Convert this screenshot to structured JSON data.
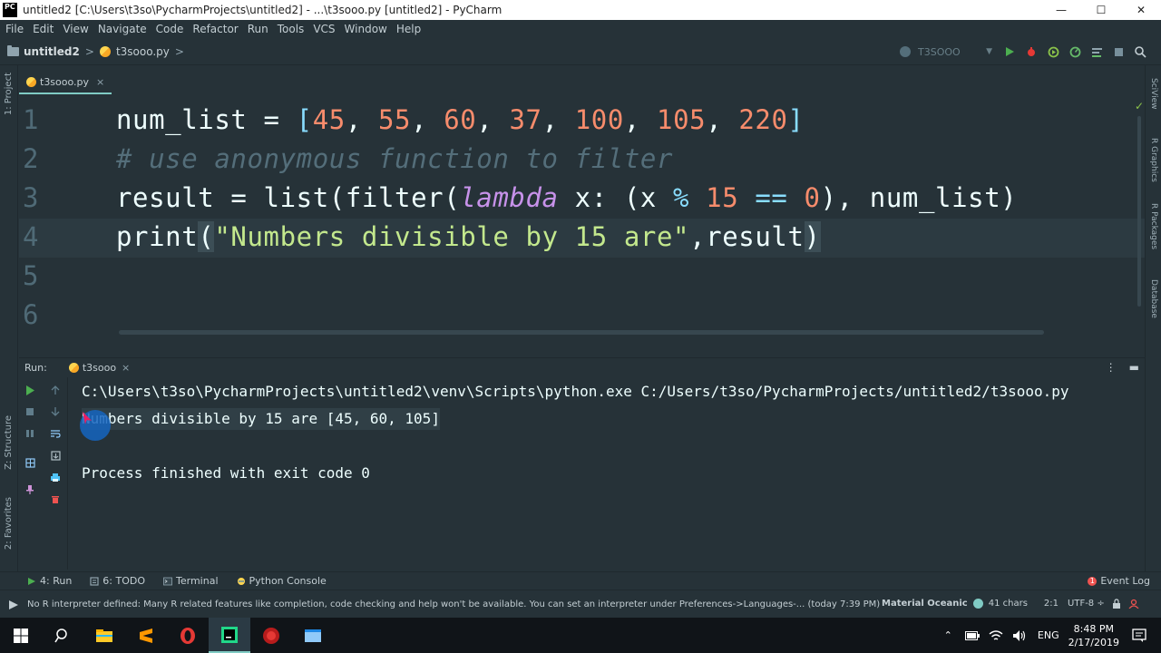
{
  "window": {
    "title": "untitled2 [C:\\Users\\t3so\\PycharmProjects\\untitled2] - ...\\t3sooo.py [untitled2] - PyCharm",
    "app_icon_text": "PC",
    "minimize": "—",
    "maximize": "☐",
    "close": "✕"
  },
  "menu": [
    "File",
    "Edit",
    "View",
    "Navigate",
    "Code",
    "Refactor",
    "Run",
    "Tools",
    "VCS",
    "Window",
    "Help"
  ],
  "nav": {
    "project": "untitled2",
    "sep": ">",
    "file": "t3sooo.py",
    "run_config": "T3SOOO"
  },
  "left_strip": {
    "project_label": "1: Project",
    "structure_label": "Z: Structure",
    "favorites_label": "2: Favorites"
  },
  "right_strip": {
    "sciview": "SciView",
    "r_graphics": "R Graphics",
    "r_packages": "R Packages",
    "database": "Database"
  },
  "editor": {
    "tab": "t3sooo.py",
    "tab_close": "×",
    "line_numbers": [
      "1",
      "2",
      "3",
      "4",
      "5",
      "6"
    ],
    "lines": {
      "l1_name": "num_list",
      "l1_eq": " = ",
      "l1_open": "[",
      "l1_nums": [
        "45",
        "55",
        "60",
        "37",
        "100",
        "105",
        "220"
      ],
      "l1_close": "]",
      "l1_sep": ", ",
      "l2_comment": "# use anonymous function to filter",
      "l3_a": "result = list(filter(",
      "l3_kw": "lambda",
      "l3_b": " x: (x ",
      "l3_op": "%",
      "l3_c": " ",
      "l3_n1": "15",
      "l3_d": " ",
      "l3_op2": "==",
      "l3_e": " ",
      "l3_n2": "0",
      "l3_f": "), num_list)",
      "l4_a": "print",
      "l4_paren": "(",
      "l4_str": "\"Numbers divisible by 15 are\"",
      "l4_b": ",result",
      "l4_close": ")"
    }
  },
  "run_panel": {
    "label": "Run:",
    "tab": "t3sooo",
    "tab_close": "×",
    "cmd": "C:\\Users\\t3so\\PycharmProjects\\untitled2\\venv\\Scripts\\python.exe C:/Users/t3so/PycharmProjects/untitled2/t3sooo.py",
    "output": "Numbers divisible by 15 are [45, 60, 105]",
    "exit": "Process finished with exit code 0"
  },
  "tool_tabs": {
    "run": "4: Run",
    "todo": "6: TODO",
    "terminal": "Terminal",
    "python_console": "Python Console",
    "event_log": "Event Log",
    "event_count": "1"
  },
  "status": {
    "message": "No R interpreter defined: Many R related features like completion, code checking and help won't be available. You can set an interpreter under Preferences->Languages-... (today 7:39 PM)",
    "theme": "Material Oceanic",
    "chars": "41 chars",
    "position": "2:1",
    "encoding": "UTF-8 ÷"
  },
  "taskbar": {
    "lang": "ENG",
    "time": "8:48 PM",
    "date": "2/17/2019"
  },
  "colors": {
    "bg": "#263238",
    "number": "#f78c6c",
    "comment": "#546e7a",
    "keyword": "#c792ea",
    "string": "#c3e88d"
  }
}
